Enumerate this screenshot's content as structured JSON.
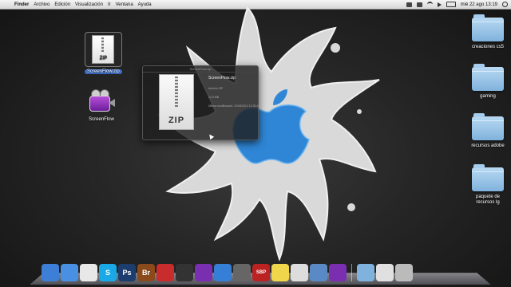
{
  "menubar": {
    "items": [
      "Finder",
      "Archivo",
      "Edición",
      "Visualización",
      "Ir",
      "Ventana",
      "Ayuda"
    ],
    "clock": "mié 22 ago  13:19",
    "wifi": "",
    "battery": ""
  },
  "desktop": {
    "left_icons": [
      {
        "label": "ScreenFlow.zip",
        "doc_text": "ZIP"
      },
      {
        "label": "ScreenFlow"
      }
    ],
    "folders": [
      {
        "label": "creaciones cs5"
      },
      {
        "label": "gaming"
      },
      {
        "label": "recursos adobe"
      },
      {
        "label": "paquete de recursos lg"
      }
    ]
  },
  "quicklook": {
    "title": "ScreenFlow.zip",
    "doc_text": "ZIP",
    "name": "ScreenFlow.zip",
    "kind": "Archivo ZIP",
    "size": "12,3 MB",
    "modified": "Última modificación: 22/08/2012 12:30:15"
  },
  "dock": {
    "apps": [
      {
        "name": "finder-icon",
        "glyph": "",
        "color": "#3d7fd6"
      },
      {
        "name": "safari-icon",
        "glyph": "",
        "color": "#4a90e2"
      },
      {
        "name": "chrome-icon",
        "glyph": "",
        "color": "#e8e8e8"
      },
      {
        "name": "skype-icon",
        "glyph": "S",
        "color": "#19a9e6"
      },
      {
        "name": "photoshop-icon",
        "glyph": "Ps",
        "color": "#1c3d6e"
      },
      {
        "name": "bridge-icon",
        "glyph": "Br",
        "color": "#8a4a1c"
      },
      {
        "name": "acrobat-icon",
        "glyph": "",
        "color": "#c92c2c"
      },
      {
        "name": "dashboard-icon",
        "glyph": "",
        "color": "#333"
      },
      {
        "name": "screenflow-dock-icon",
        "glyph": "",
        "color": "#7a2fb0"
      },
      {
        "name": "itunes-icon",
        "glyph": "",
        "color": "#3580d6"
      },
      {
        "name": "app-star-icon",
        "glyph": "",
        "color": "#666"
      },
      {
        "name": "sbp-icon",
        "glyph": "SBP",
        "color": "#b22"
      },
      {
        "name": "stickies-icon",
        "glyph": "",
        "color": "#f0d64a"
      },
      {
        "name": "preview-icon",
        "glyph": "",
        "color": "#ddd"
      },
      {
        "name": "photo-icon",
        "glyph": "",
        "color": "#5a8ac6"
      },
      {
        "name": "screenflow-icon-2",
        "glyph": "",
        "color": "#7a2fb0"
      }
    ],
    "right_items": [
      {
        "name": "applications-folder-icon",
        "glyph": "",
        "color": "#7fb2dc"
      },
      {
        "name": "documents-stack-icon",
        "glyph": "",
        "color": "#e0e0e0"
      },
      {
        "name": "trash-icon",
        "glyph": "",
        "color": "#bbb"
      }
    ]
  }
}
